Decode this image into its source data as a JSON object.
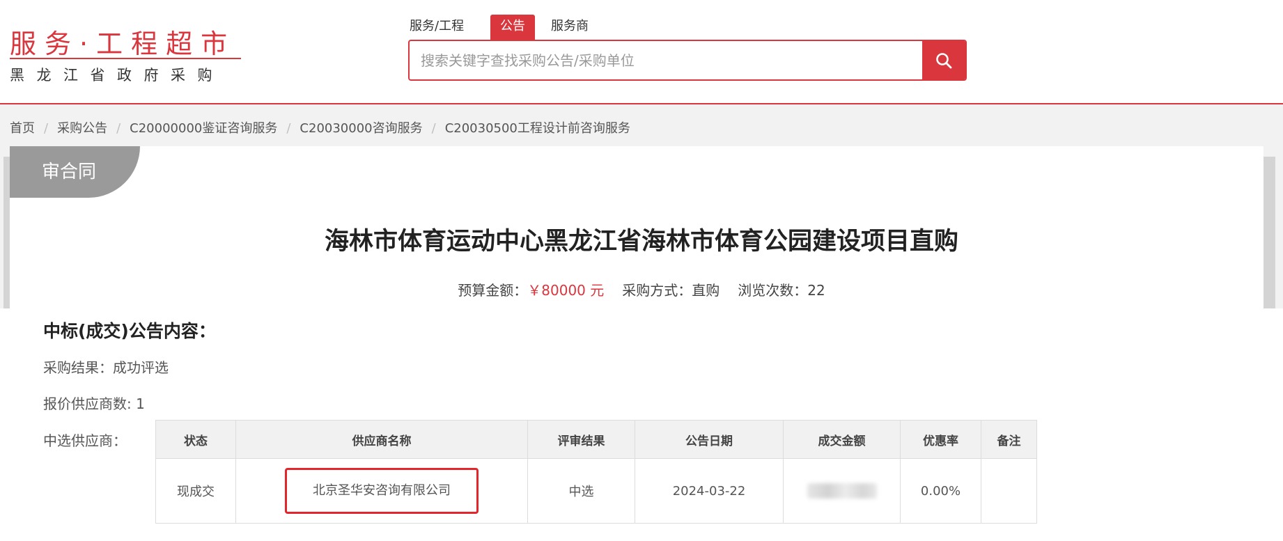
{
  "logo": {
    "title": "服务·工程超市",
    "subtitle": "黑龙江省政府采购"
  },
  "nav": {
    "tabs": [
      {
        "label": "服务/工程"
      },
      {
        "label": "公告"
      },
      {
        "label": "服务商"
      }
    ],
    "active_tab": "公告"
  },
  "search": {
    "placeholder": "搜索关键字查找采购公告/采购单位",
    "value": ""
  },
  "breadcrumb": [
    {
      "label": "首页"
    },
    {
      "label": "采购公告"
    },
    {
      "label": "C20000000鉴证咨询服务"
    },
    {
      "label": "C20030000咨询服务"
    },
    {
      "label": "C20030500工程设计前咨询服务"
    }
  ],
  "status_tag": "审合同",
  "title": "海林市体育运动中心黑龙江省海林市体育公园建设项目直购",
  "meta": {
    "budget_label": "预算金额：",
    "budget_value": "￥80000 元",
    "method_label": "采购方式：",
    "method_value": "直购",
    "views_label": "浏览次数：",
    "views_value": "22"
  },
  "section": {
    "title": "中标(成交)公告内容：",
    "result_label": "采购结果：",
    "result_value": "成功评选",
    "count_label": "报价供应商数: ",
    "count_value": "1",
    "supplier_label": "中选供应商："
  },
  "table": {
    "headers": [
      "状态",
      "供应商名称",
      "评审结果",
      "公告日期",
      "成交金额",
      "优惠率",
      "备注"
    ],
    "rows": [
      {
        "status": "现成交",
        "supplier": "北京圣华安咨询有限公司",
        "review": "中选",
        "date": "2024-03-22",
        "amount": "",
        "discount": "0.00%",
        "remark": ""
      }
    ]
  },
  "colors": {
    "brand_red": "#d9363e",
    "tag_gray": "#9a9a9a",
    "highlight_box": "#e3262b"
  }
}
